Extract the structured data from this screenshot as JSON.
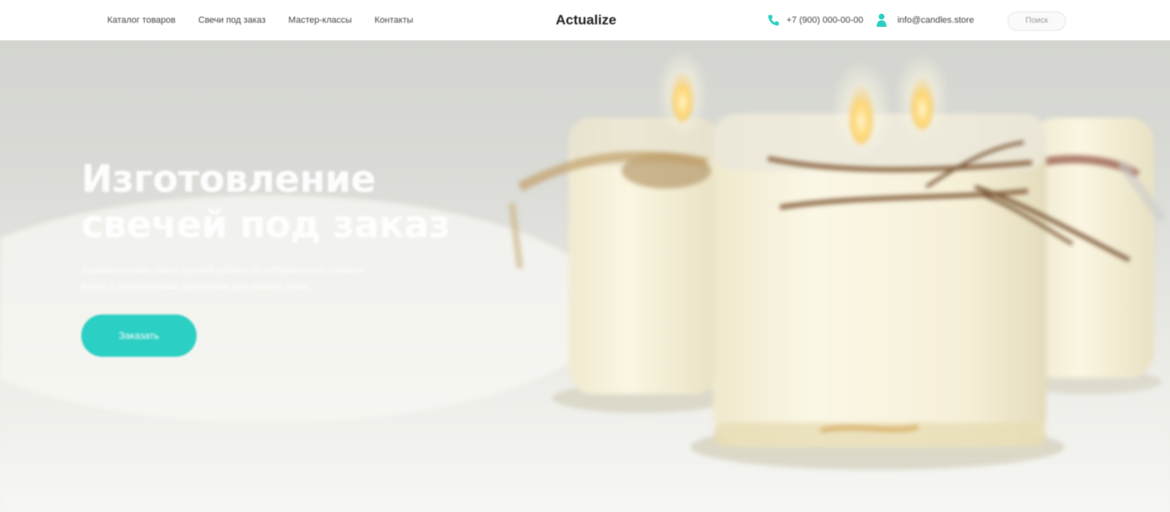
{
  "header": {
    "nav": [
      {
        "label": "Каталог товаров"
      },
      {
        "label": "Свечи под заказ"
      },
      {
        "label": "Мастер-классы"
      },
      {
        "label": "Контакты"
      }
    ],
    "logo": "Actualize",
    "phone": "+7 (900) 000-00-00",
    "email": "info@candles.store",
    "search_label": "Поиск"
  },
  "hero": {
    "title_line1": "Изготовление",
    "title_line2": "свечей под заказ",
    "subtitle": "Ароматические свечи ручной работы из натурального соевого воска с деревянными фитилями для вашего дома",
    "cta_label": "Заказать"
  },
  "colors": {
    "accent": "#2ccfc3",
    "header_bg": "#ffffff",
    "hero_text": "#ffffff"
  }
}
